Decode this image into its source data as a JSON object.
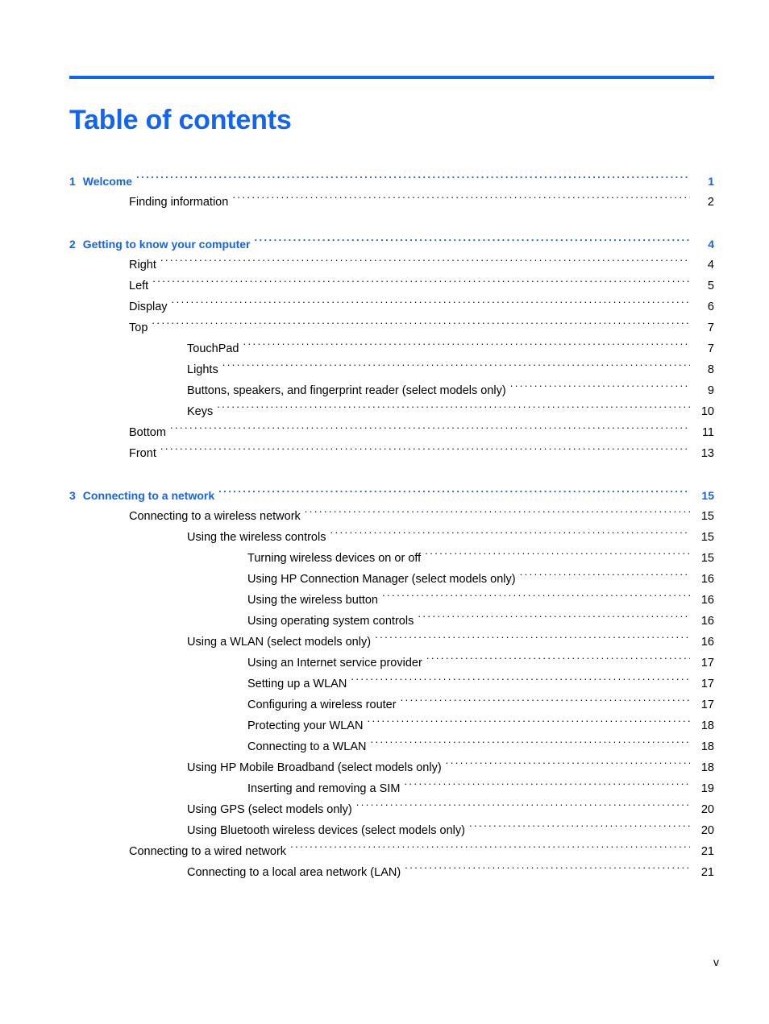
{
  "document": {
    "title": "Table of contents",
    "accent_color": "#1364f0",
    "text_color": "#000000",
    "footer_page_number": "v"
  },
  "toc": {
    "entries": [
      {
        "level": 1,
        "number": "1",
        "label": "Welcome",
        "page": "1"
      },
      {
        "level": 2,
        "number": "",
        "label": "Finding information",
        "page": "2"
      },
      {
        "level": 1,
        "number": "2",
        "label": "Getting to know your computer",
        "page": "4"
      },
      {
        "level": 2,
        "number": "",
        "label": "Right",
        "page": "4"
      },
      {
        "level": 2,
        "number": "",
        "label": "Left",
        "page": "5"
      },
      {
        "level": 2,
        "number": "",
        "label": "Display",
        "page": "6"
      },
      {
        "level": 2,
        "number": "",
        "label": "Top",
        "page": "7"
      },
      {
        "level": 3,
        "number": "",
        "label": "TouchPad",
        "page": "7"
      },
      {
        "level": 3,
        "number": "",
        "label": "Lights",
        "page": "8"
      },
      {
        "level": 3,
        "number": "",
        "label": "Buttons, speakers, and fingerprint reader (select models only)",
        "page": "9"
      },
      {
        "level": 3,
        "number": "",
        "label": "Keys",
        "page": "10"
      },
      {
        "level": 2,
        "number": "",
        "label": "Bottom",
        "page": "11"
      },
      {
        "level": 2,
        "number": "",
        "label": "Front",
        "page": "13"
      },
      {
        "level": 1,
        "number": "3",
        "label": "Connecting to a network",
        "page": "15"
      },
      {
        "level": 2,
        "number": "",
        "label": "Connecting to a wireless network",
        "page": "15"
      },
      {
        "level": 3,
        "number": "",
        "label": "Using the wireless controls",
        "page": "15"
      },
      {
        "level": 4,
        "number": "",
        "label": "Turning wireless devices on or off",
        "page": "15"
      },
      {
        "level": 4,
        "number": "",
        "label": "Using HP Connection Manager (select models only)",
        "page": "16"
      },
      {
        "level": 4,
        "number": "",
        "label": "Using the wireless button",
        "page": "16"
      },
      {
        "level": 4,
        "number": "",
        "label": "Using operating system controls",
        "page": "16"
      },
      {
        "level": 3,
        "number": "",
        "label": "Using a WLAN (select models only)",
        "page": "16"
      },
      {
        "level": 4,
        "number": "",
        "label": "Using an Internet service provider",
        "page": "17"
      },
      {
        "level": 4,
        "number": "",
        "label": "Setting up a WLAN",
        "page": "17"
      },
      {
        "level": 4,
        "number": "",
        "label": "Configuring a wireless router",
        "page": "17"
      },
      {
        "level": 4,
        "number": "",
        "label": "Protecting your WLAN",
        "page": "18"
      },
      {
        "level": 4,
        "number": "",
        "label": "Connecting to a WLAN",
        "page": "18"
      },
      {
        "level": 3,
        "number": "",
        "label": "Using HP Mobile Broadband (select models only)",
        "page": "18"
      },
      {
        "level": 4,
        "number": "",
        "label": "Inserting and removing a SIM",
        "page": "19"
      },
      {
        "level": 3,
        "number": "",
        "label": "Using GPS (select models only)",
        "page": "20"
      },
      {
        "level": 3,
        "number": "",
        "label": "Using Bluetooth wireless devices (select models only)",
        "page": "20"
      },
      {
        "level": 2,
        "number": "",
        "label": "Connecting to a wired network",
        "page": "21"
      },
      {
        "level": 3,
        "number": "",
        "label": "Connecting to a local area network (LAN)",
        "page": "21"
      }
    ]
  }
}
